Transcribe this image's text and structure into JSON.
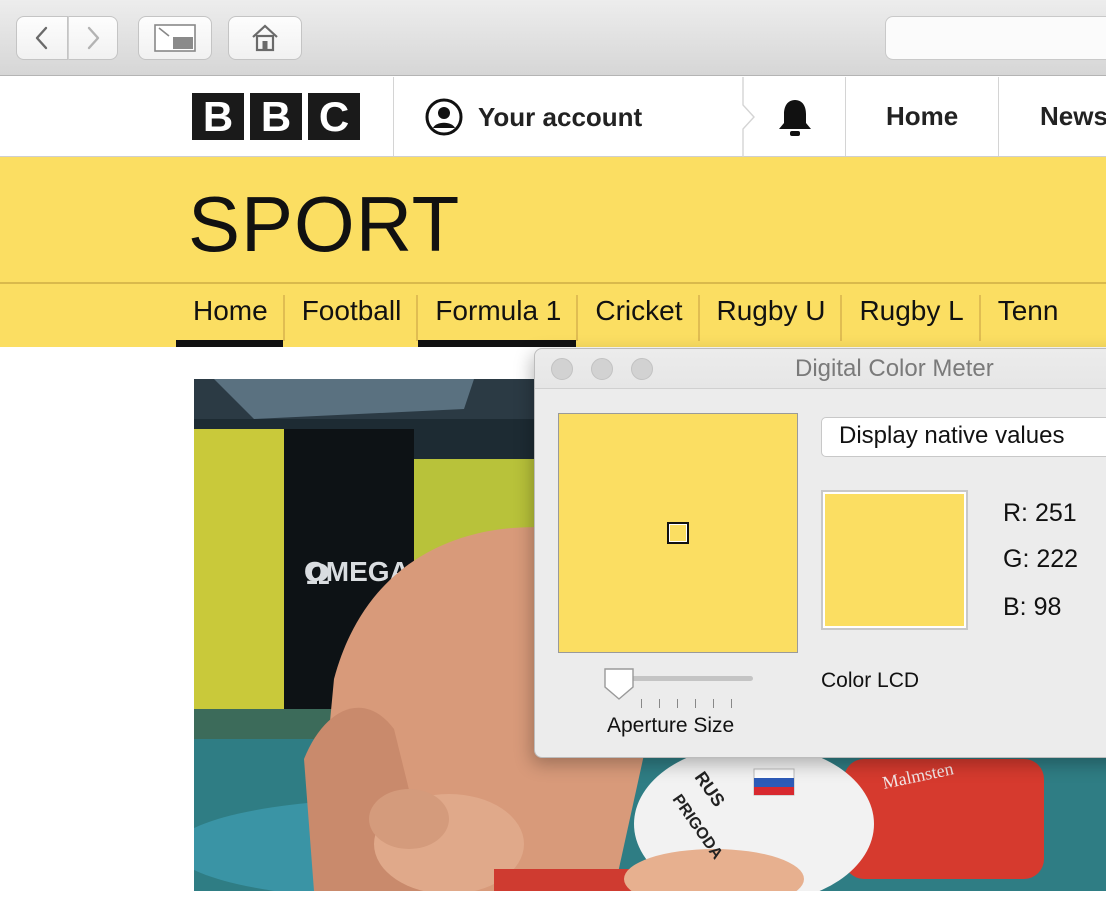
{
  "browser": {
    "back_icon": "chevron-left-icon",
    "forward_icon": "chevron-right-icon",
    "tabs_icon": "tab-overview-icon",
    "home_icon": "home-icon"
  },
  "bbc_header": {
    "logo_letters": [
      "B",
      "B",
      "C"
    ],
    "account_label": "Your account",
    "account_icon": "user-circle-icon",
    "bell_icon": "bell-icon",
    "nav": [
      "Home",
      "News"
    ]
  },
  "sport": {
    "title": "SPORT",
    "nav": [
      "Home",
      "Football",
      "Formula 1",
      "Cricket",
      "Rugby U",
      "Rugby L",
      "Tenn"
    ],
    "highlight_color": "#fbde62"
  },
  "photo": {
    "sign_brand": "OMEGA",
    "cap_text": "RUS",
    "cap_name": "PRIGODA",
    "float_brand": "Malmsten"
  },
  "color_meter": {
    "title": "Digital Color Meter",
    "mode": "Display native values",
    "r_label": "R:",
    "r_value": "251",
    "g_label": "G:",
    "g_value": "222",
    "b_label": "B:",
    "b_value": "98",
    "display_name": "Color LCD",
    "aperture_label": "Aperture Size",
    "sampled_color": "#fbde62",
    "aperture_level": 0
  }
}
